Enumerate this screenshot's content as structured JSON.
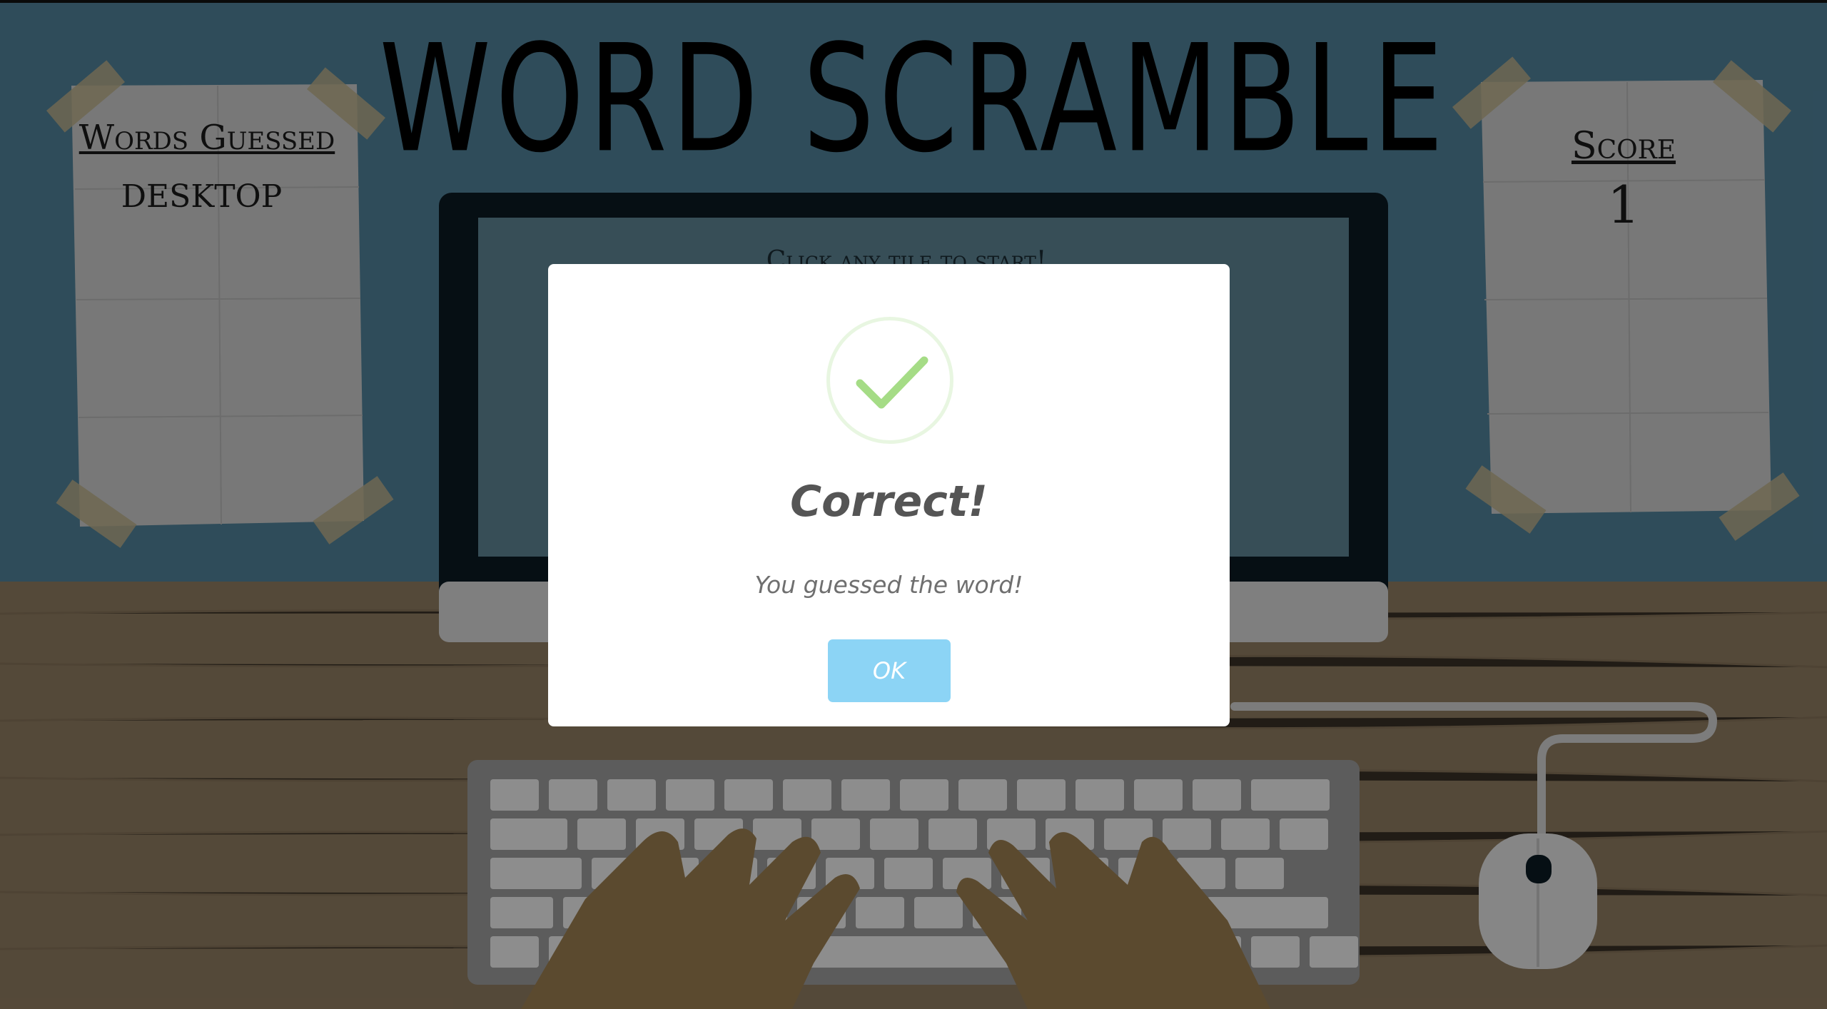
{
  "game": {
    "title": "WORD SCRAMBLE"
  },
  "words_poster": {
    "label": "Words Guessed",
    "words": [
      "DESKTOP"
    ]
  },
  "score_poster": {
    "label": "Score",
    "value": "1"
  },
  "screen": {
    "message": "Click any tile to start!"
  },
  "modal": {
    "title": "Correct!",
    "text": "You guessed the word!",
    "ok_label": "OK",
    "icon": "checkmark-icon",
    "button_color": "#8cd4f5",
    "check_color": "#a5dc86"
  },
  "colors": {
    "wall": "#4f7f97",
    "desk": "#8d7a5f",
    "monitor_frame": "#0b1a22",
    "hands": "#987c4f"
  }
}
